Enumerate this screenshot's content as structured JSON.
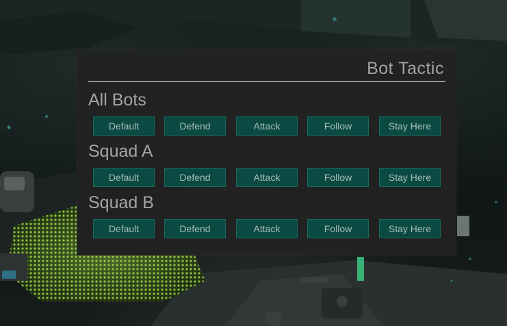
{
  "panel": {
    "title": "Bot Tactic"
  },
  "groups": [
    {
      "label": "All Bots",
      "buttons": [
        "Default",
        "Defend",
        "Attack",
        "Follow",
        "Stay Here"
      ]
    },
    {
      "label": "Squad A",
      "buttons": [
        "Default",
        "Defend",
        "Attack",
        "Follow",
        "Stay Here"
      ]
    },
    {
      "label": "Squad B",
      "buttons": [
        "Default",
        "Defend",
        "Attack",
        "Follow",
        "Stay Here"
      ]
    }
  ],
  "colors": {
    "panel_bg": "#222222",
    "button_bg": "#0b4a43",
    "button_border": "#166a60",
    "text_gray": "#a4a4a4",
    "grate_green": "#7fbf3a"
  }
}
